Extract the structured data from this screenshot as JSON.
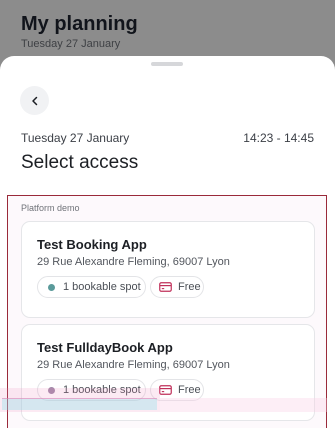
{
  "background": {
    "title": "My planning",
    "date": "Tuesday 27 January"
  },
  "sheet": {
    "date": "Tuesday 27 January",
    "time_range": "14:23 - 14:45",
    "heading": "Select access",
    "back_icon": "chevron-left-icon"
  },
  "section": {
    "label": "Platform demo"
  },
  "cards": [
    {
      "title": "Test Booking App",
      "address": "29 Rue Alexandre Fleming, 69007 Lyon",
      "spots": "1 bookable spot",
      "price": "Free",
      "dot_color": "#5a9a9a"
    },
    {
      "title": "Test FulldayBook App",
      "address": "29 Rue Alexandre Fleming, 69007 Lyon",
      "spots": "1 bookable spot",
      "price": "Free",
      "dot_color": "#a088a8"
    }
  ],
  "colors": {
    "accent_border": "#9a2a3a",
    "price_icon": "#c0305a"
  }
}
